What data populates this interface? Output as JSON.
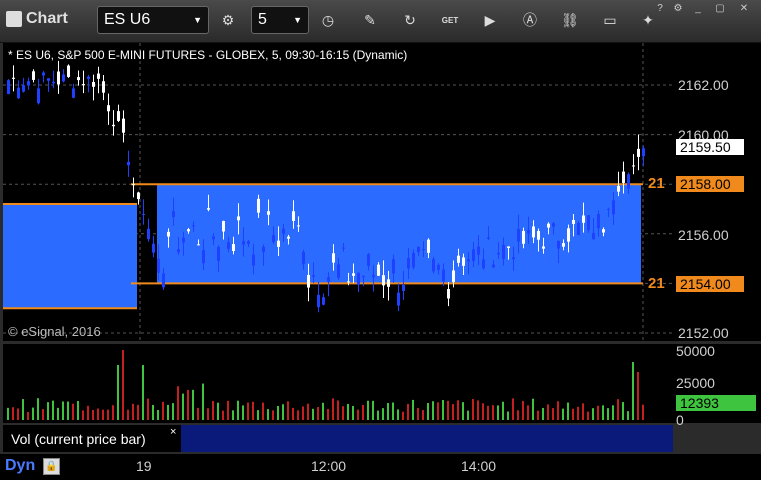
{
  "app": {
    "title": "Chart"
  },
  "toolbar": {
    "symbol": "ES U6",
    "interval": "5",
    "button_icons": [
      "pencil-icon",
      "refresh-icon",
      "get-icon",
      "play-icon",
      "alert-icon",
      "link-icon",
      "chat-icon",
      "twitter-icon"
    ],
    "get_label": "GET"
  },
  "chart": {
    "title": "* ES U6, S&P 500 E-MINI FUTURES - GLOBEX, 5, 09:30-16:15 (Dynamic)",
    "copyright": "© eSignal, 2016",
    "price_labels": [
      "2162.00",
      "2160.00",
      "2158.00",
      "2156.00",
      "2154.00",
      "2152.00"
    ],
    "last_price": "2159.50",
    "upper_level": "2158.00",
    "lower_level": "2154.00",
    "upper_level_short": "21",
    "lower_level_short": "21",
    "colors": {
      "zone": "#2b6bff",
      "level": "#f08a1c",
      "up": "#ffffff",
      "down": "#1e40ff",
      "vol_up": "#3ec43e",
      "vol_down": "#c42020",
      "vol_last": "#3ec43e"
    }
  },
  "volume": {
    "label": "Vol (current price bar)",
    "close": "×",
    "axis_labels": [
      "50000",
      "25000",
      "0"
    ],
    "last_value": "12393"
  },
  "time_axis": {
    "labels": [
      "19",
      "12:00",
      "14:00"
    ]
  },
  "status": {
    "mode": "Dyn"
  }
}
